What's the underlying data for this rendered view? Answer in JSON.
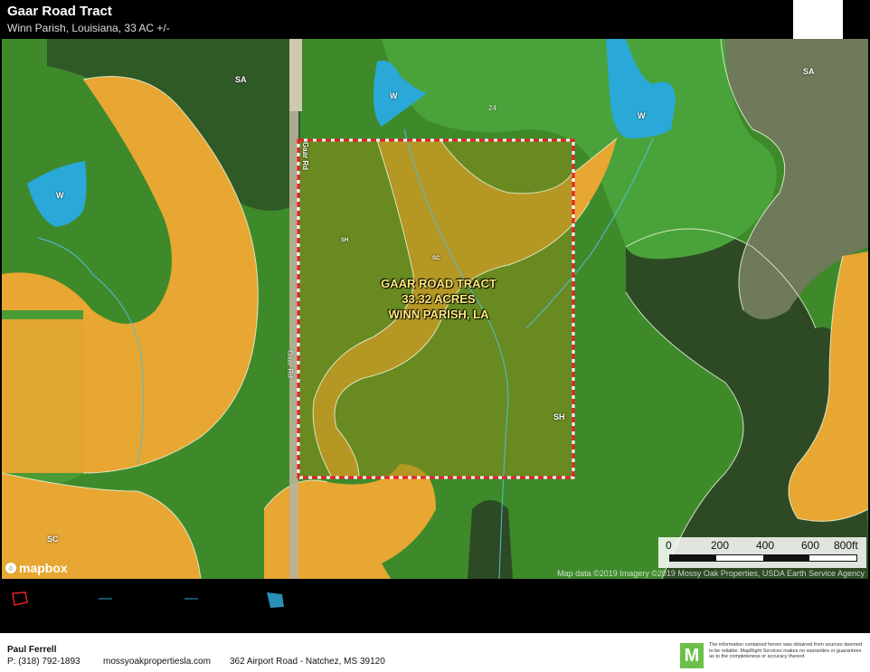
{
  "header": {
    "title": "Gaar Road Tract",
    "subtitle": "Winn Parish, Louisiana, 33 AC +/-"
  },
  "map": {
    "tract_label": [
      "GAAR ROAD TRACT",
      "33.32 ACRES",
      "WINN PARISH, LA"
    ],
    "soil_labels": {
      "sa_top": "SA",
      "sa_right": "SA",
      "w_top": "W",
      "w_right": "W",
      "w_left": "W",
      "sh_inner": "SH",
      "sc_inner": "SC",
      "sh_right": "SH",
      "sc_bottom": "SC"
    },
    "road_label_top": "Gaar Rd",
    "road_label_mid": "Gaar Rd",
    "route_number": "24",
    "scale": {
      "labels": [
        "0",
        "200",
        "400",
        "600",
        "800ft"
      ]
    },
    "attribution": "Map data ©2019  Imagery ©2019  Mossy Oak Properties, USDA Earth Service Agency",
    "mapbox_label": "mapbox",
    "colors": {
      "forest": "#3f8a2c",
      "sc_orange": "#e8a632",
      "sh_olive": "#7a8a22",
      "water": "#2aa8d8",
      "boundary": "#e8202a"
    }
  },
  "legend": {
    "icons": [
      "boundary-swatch",
      "stream-line",
      "stream-line-2",
      "water-swatch"
    ]
  },
  "footer": {
    "agent": "Paul Ferrell",
    "phone": "P: (318) 792-1893",
    "website": "mossyoakpropertiesla.com",
    "address": "362 Airport Road - Natchez, MS 39120",
    "logo_letter": "M",
    "disclaimer": "The information contained herein was obtained from sources deemed to be reliable. MapRight Services makes no warranties or guarantees as to the completeness or accuracy thereof."
  }
}
